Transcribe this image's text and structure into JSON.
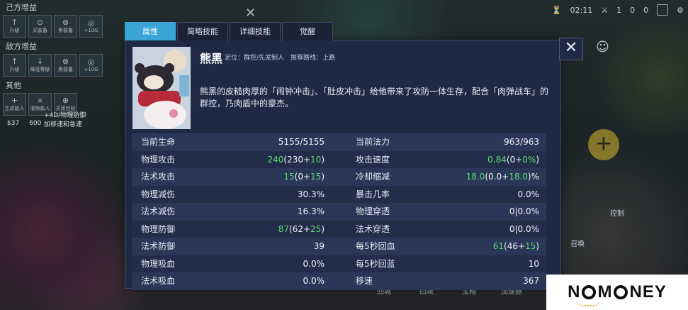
{
  "background": {
    "left_panel": {
      "section1_title": "己方增益",
      "section1_buttons": [
        "升级",
        "买装备",
        "卖装备",
        "+10G"
      ],
      "section2_title": "敌方增益",
      "section2_buttons": [
        "升级",
        "降低等级",
        "卖装备",
        "+10G"
      ],
      "section3_title": "其他",
      "section3_buttons": [
        "生成敌人",
        "清除敌人",
        "关闭目标"
      ],
      "gold_value": "$37",
      "gold_value2": "600",
      "buff_text": "+4D/物理防御",
      "buff_text2": "加移速和急速"
    },
    "topbar": {
      "time": "02:11",
      "kills": "1",
      "score": "0",
      "level": "0"
    },
    "bottom_menu": [
      "回城",
      "回城",
      "宝箱",
      "加速器"
    ],
    "side_label": "控制",
    "side_label2": "召唤"
  },
  "tabs": [
    {
      "label": "属性",
      "active": true
    },
    {
      "label": "简略技能",
      "active": false
    },
    {
      "label": "详细技能",
      "active": false
    },
    {
      "label": "觉醒",
      "active": false
    }
  ],
  "close_symbol": "✕",
  "hero": {
    "name": "熊黑",
    "meta": "定位：群控/先发制人　推荐路线：上路",
    "description": "熊黑的皮糙肉厚的「闹钟冲击」、「肚皮冲击」给他带来了攻防一体生存，配合「肉弹战车」的群控，乃肉盾中的豪杰。"
  },
  "stats": [
    {
      "left": {
        "label": "当前生命",
        "value": "5155/5155"
      },
      "right": {
        "label": "当前法力",
        "value": "963/963"
      }
    },
    {
      "left": {
        "label": "物理攻击",
        "value_prefix": "240",
        "value_main": "(230+",
        "value_green": "10",
        "value_suffix": ")"
      },
      "right": {
        "label": "攻击速度",
        "value_prefix": "0.84",
        "value_main": "(0+",
        "value_green": "0%",
        "value_suffix": ")"
      }
    },
    {
      "left": {
        "label": "法术攻击",
        "value_prefix": "15",
        "value_main": "(0+",
        "value_green": "15",
        "value_suffix": ")"
      },
      "right": {
        "label": "冷却缩减",
        "value_prefix": "18.0",
        "value_main": "(0.0+",
        "value_green": "18.0",
        "value_suffix": ")%"
      }
    },
    {
      "left": {
        "label": "物理减伤",
        "value": "30.3%"
      },
      "right": {
        "label": "暴击几率",
        "value": "0.0%"
      }
    },
    {
      "left": {
        "label": "法术减伤",
        "value": "16.3%"
      },
      "right": {
        "label": "物理穿透",
        "value": "0|0.0%"
      }
    },
    {
      "left": {
        "label": "物理防御",
        "value_prefix": "87",
        "value_main": "(62+",
        "value_green": "25",
        "value_suffix": ")"
      },
      "right": {
        "label": "法术穿透",
        "value": "0|0.0%"
      }
    },
    {
      "left": {
        "label": "法术防御",
        "value": "39"
      },
      "right": {
        "label": "每5秒回血",
        "value_prefix": "61",
        "value_main": "(46+",
        "value_green": "15",
        "value_suffix": ")"
      }
    },
    {
      "left": {
        "label": "物理吸血",
        "value": "0.0%"
      },
      "right": {
        "label": "每5秒回蓝",
        "value": "10"
      }
    },
    {
      "left": {
        "label": "法术吸血",
        "value": "0.0%"
      },
      "right": {
        "label": "移速",
        "value": "367"
      }
    }
  ],
  "colors": {
    "accent_tab": "#3aa4d8",
    "bonus_green": "#62d86a",
    "panel_bg": "#1e2944"
  },
  "watermark": {
    "text_left": "N",
    "text_mid": "M",
    "text_mid2": "NEY"
  }
}
